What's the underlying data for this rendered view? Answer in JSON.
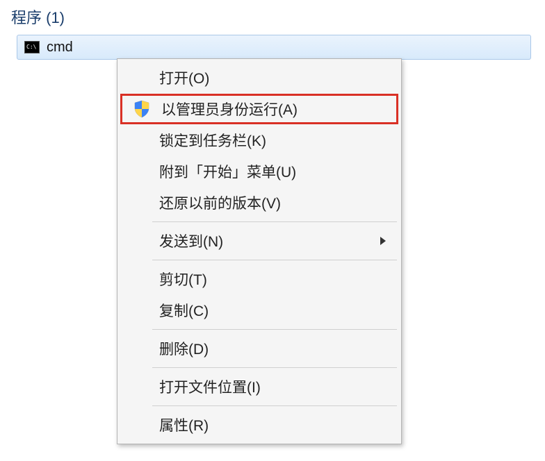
{
  "header": {
    "title": "程序 (1)"
  },
  "result": {
    "name": "cmd"
  },
  "menu": {
    "open": "打开(O)",
    "run_admin": "以管理员身份运行(A)",
    "pin_taskbar": "锁定到任务栏(K)",
    "pin_start": "附到「开始」菜单(U)",
    "restore": "还原以前的版本(V)",
    "send_to": "发送到(N)",
    "cut": "剪切(T)",
    "copy": "复制(C)",
    "delete": "删除(D)",
    "open_location": "打开文件位置(I)",
    "properties": "属性(R)"
  }
}
